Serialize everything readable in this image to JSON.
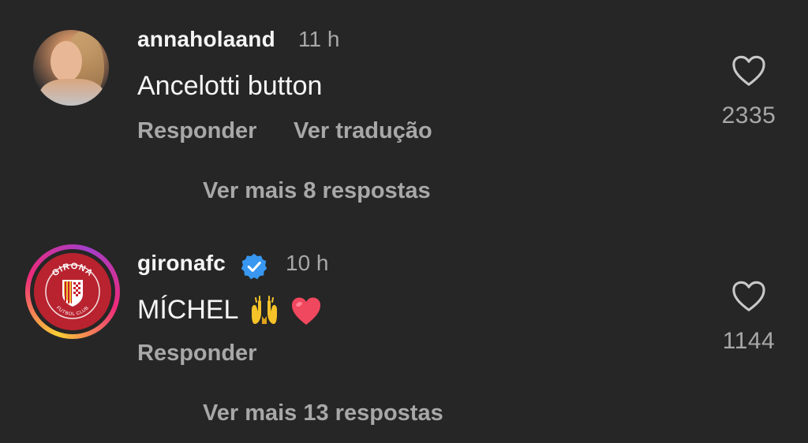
{
  "comments": [
    {
      "username": "annaholaand",
      "time": "11 h",
      "text": "Ancelotti button",
      "reply_label": "Responder",
      "translate_label": "Ver tradução",
      "likes": "2335",
      "more_replies": "Ver mais 8 respostas",
      "avatar": "user-photo"
    },
    {
      "username": "gironafc",
      "time": "10 h",
      "text": "MÍCHEL",
      "emojis": [
        "raising-hands-emoji",
        "red-heart-emoji"
      ],
      "reply_label": "Responder",
      "likes": "1144",
      "more_replies": "Ver mais 13 respostas",
      "verified": true,
      "avatar": "girona-fc-crest",
      "avatar_crest_text": [
        "GIRONA",
        "FUTBOL CLUB"
      ]
    }
  ],
  "colors": {
    "background": "#262626",
    "primary_text": "#f5f5f5",
    "secondary_text": "#a8a8a8",
    "verified_badge": "#3897f0",
    "heart_emoji": "#f0485f",
    "crest_red": "#b8232f"
  },
  "icons": {
    "like": "heart-outline-icon",
    "verified": "verified-badge-icon"
  }
}
